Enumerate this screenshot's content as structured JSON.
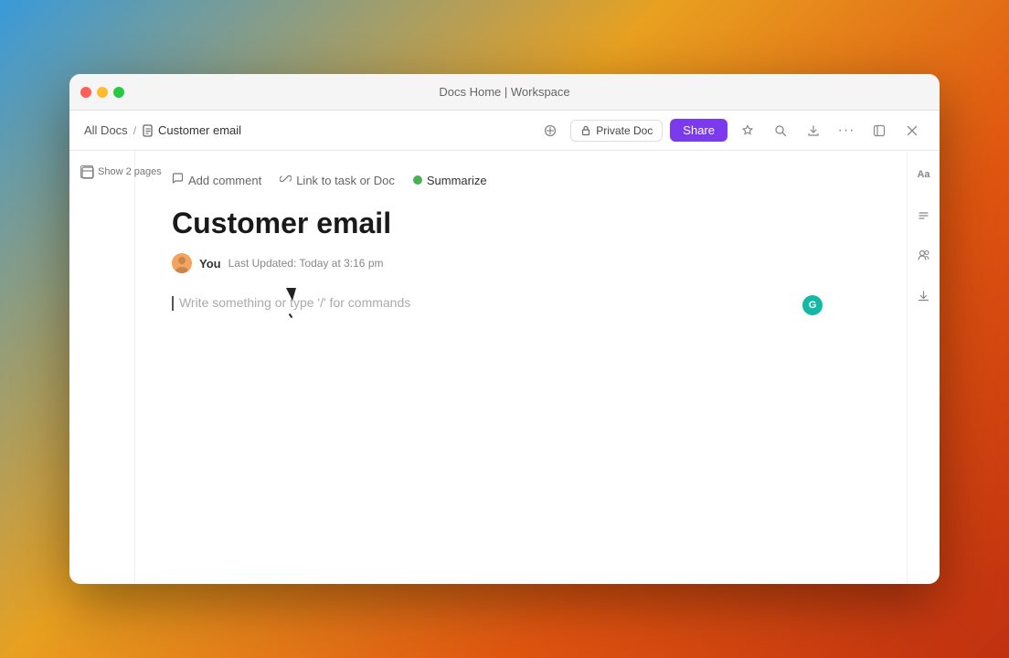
{
  "window": {
    "title": "Docs Home | Workspace"
  },
  "titlebar": {
    "title": "Docs Home | Workspace"
  },
  "breadcrumb": {
    "all_docs": "All Docs",
    "separator": "/",
    "current": "Customer email"
  },
  "toolbar": {
    "private_doc_label": "Private Doc",
    "share_label": "Share"
  },
  "left_sidebar": {
    "show_pages_label": "Show 2 pages"
  },
  "doc_toolbar": {
    "add_comment": "Add comment",
    "link_task": "Link to task or Doc",
    "summarize": "Summarize"
  },
  "document": {
    "title": "Customer email",
    "author": "You",
    "last_updated": "Last Updated: Today at 3:16 pm",
    "placeholder": "Write something or type '/' for commands"
  },
  "teal_indicator": {
    "letter": "G"
  },
  "right_sidebar_buttons": [
    {
      "name": "text-format-btn",
      "icon": "Aa"
    },
    {
      "name": "collapse-btn",
      "icon": "↑"
    },
    {
      "name": "users-btn",
      "icon": "👤"
    },
    {
      "name": "download-btn",
      "icon": "↓"
    }
  ]
}
